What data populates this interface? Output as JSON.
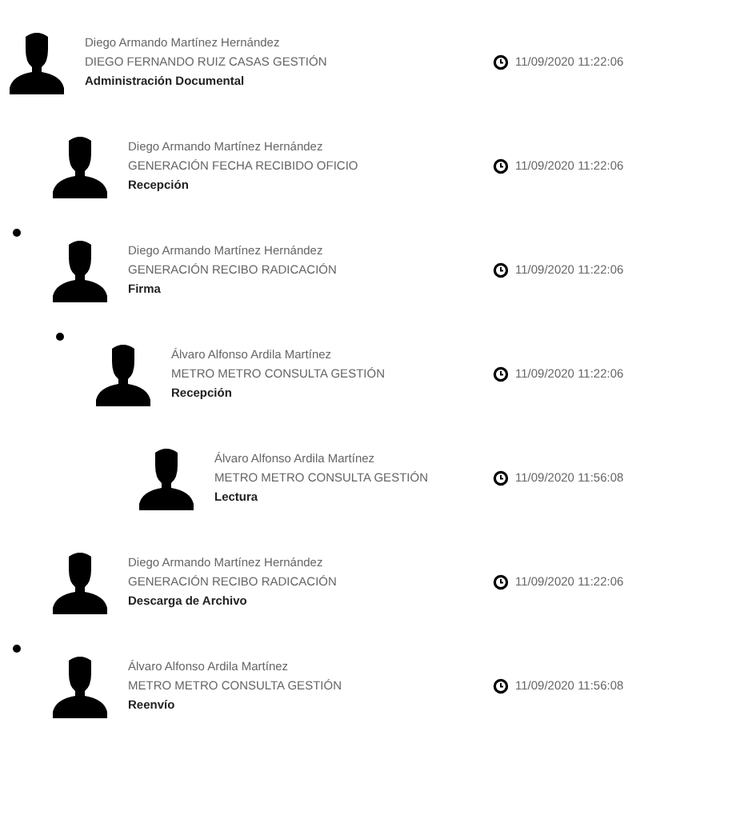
{
  "entries": [
    {
      "name": "Diego Armando Martínez Hernández",
      "detail": "DIEGO FERNANDO RUIZ CASAS GESTIÓN",
      "action": "Administración Documental",
      "time": "11/09/2020 11:22:06",
      "expanded": false,
      "children": [
        {
          "name": "Diego Armando Martínez Hernández",
          "detail": "GENERACIÓN FECHA RECIBIDO OFICIO",
          "action": "Recepción",
          "time": "11/09/2020 11:22:06",
          "expanded": false
        },
        {
          "name": "Diego Armando Martínez Hernández",
          "detail": "GENERACIÓN RECIBO RADICACIÓN",
          "action": "Firma",
          "time": "11/09/2020 11:22:06",
          "expanded": true,
          "children": [
            {
              "name": "Álvaro Alfonso Ardila Martínez",
              "detail": "METRO METRO CONSULTA GESTIÓN",
              "action": "Recepción",
              "time": "11/09/2020 11:22:06",
              "expanded": true,
              "children": [
                {
                  "name": "Álvaro Alfonso Ardila Martínez",
                  "detail": "METRO METRO CONSULTA GESTIÓN",
                  "action": "Lectura",
                  "time": "11/09/2020 11:56:08",
                  "expanded": false
                }
              ]
            }
          ]
        },
        {
          "name": "Diego Armando Martínez Hernández",
          "detail": "GENERACIÓN RECIBO RADICACIÓN",
          "action": "Descarga de Archivo",
          "time": "11/09/2020 11:22:06",
          "expanded": false
        },
        {
          "name": "Álvaro Alfonso Ardila Martínez",
          "detail": "METRO METRO CONSULTA GESTIÓN",
          "action": "Reenvío",
          "time": "11/09/2020 11:56:08",
          "expanded": true
        }
      ]
    }
  ]
}
